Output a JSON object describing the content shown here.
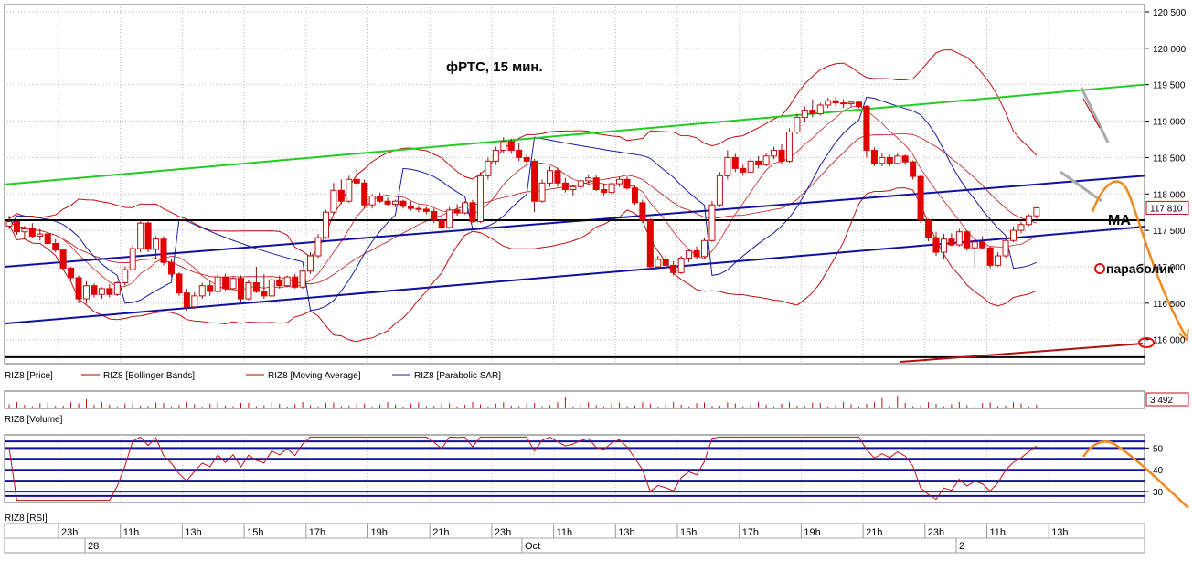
{
  "chart_data": [
    {
      "type": "candlestick",
      "title": "фРТС, 15 мин.",
      "price_axis_ticks": [
        "120 500",
        "120 000",
        "119 500",
        "119 000",
        "118 500",
        "118 000",
        "117 500",
        "117 000",
        "116 500",
        "116 000"
      ],
      "ylim": [
        115670,
        120600
      ],
      "last_price_label": "117 810",
      "last_price": 117810,
      "legend": [
        {
          "name": "RIZ8 [Price]",
          "color": "#000000"
        },
        {
          "name": "RIZ8 [Bollinger Bands]",
          "color": "#b00000"
        },
        {
          "name": "RIZ8 [Moving Average]",
          "color": "#b00000"
        },
        {
          "name": "RIZ8 [Parabolic SAR]",
          "color": "#1a1aa0"
        }
      ],
      "candles": [
        [
          117560,
          117700,
          117520,
          117620
        ],
        [
          117620,
          117640,
          117440,
          117480
        ],
        [
          117480,
          117560,
          117380,
          117520
        ],
        [
          117520,
          117600,
          117400,
          117420
        ],
        [
          117420,
          117520,
          117360,
          117450
        ],
        [
          117450,
          117470,
          117300,
          117320
        ],
        [
          117320,
          117380,
          117200,
          117230
        ],
        [
          117230,
          117250,
          116950,
          116980
        ],
        [
          116980,
          117000,
          116820,
          116850
        ],
        [
          116850,
          116880,
          116500,
          116560
        ],
        [
          116560,
          116800,
          116500,
          116740
        ],
        [
          116740,
          116770,
          116580,
          116620
        ],
        [
          116620,
          116720,
          116560,
          116700
        ],
        [
          116700,
          116760,
          116580,
          116620
        ],
        [
          116620,
          116800,
          116600,
          116780
        ],
        [
          116780,
          117000,
          116740,
          116960
        ],
        [
          116960,
          117300,
          116940,
          117250
        ],
        [
          117250,
          117650,
          117200,
          117600
        ],
        [
          117600,
          117640,
          117200,
          117240
        ],
        [
          117240,
          117420,
          117100,
          117380
        ],
        [
          117380,
          117420,
          117020,
          117060
        ],
        [
          117060,
          117100,
          116860,
          116900
        ],
        [
          116900,
          116920,
          116600,
          116640
        ],
        [
          116640,
          116700,
          116400,
          116450
        ],
        [
          116450,
          116650,
          116420,
          116600
        ],
        [
          116600,
          116780,
          116560,
          116740
        ],
        [
          116740,
          116800,
          116600,
          116660
        ],
        [
          116660,
          116900,
          116640,
          116860
        ],
        [
          116860,
          116900,
          116660,
          116700
        ],
        [
          116700,
          116860,
          116680,
          116840
        ],
        [
          116840,
          116880,
          116520,
          116560
        ],
        [
          116560,
          116820,
          116540,
          116780
        ],
        [
          116780,
          117000,
          116640,
          116660
        ],
        [
          116660,
          116900,
          116560,
          116600
        ],
        [
          116600,
          116840,
          116580,
          116820
        ],
        [
          116820,
          116880,
          116700,
          116740
        ],
        [
          116740,
          116880,
          116720,
          116860
        ],
        [
          116860,
          116900,
          116700,
          116720
        ],
        [
          116720,
          116960,
          116700,
          116940
        ],
        [
          116940,
          117200,
          116900,
          117150
        ],
        [
          117150,
          117450,
          117120,
          117400
        ],
        [
          117400,
          117780,
          117380,
          117750
        ],
        [
          117750,
          118150,
          117720,
          118050
        ],
        [
          118050,
          118200,
          117860,
          117900
        ],
        [
          117900,
          118250,
          117880,
          118200
        ],
        [
          118200,
          118350,
          118100,
          118150
        ],
        [
          118150,
          118200,
          117800,
          117850
        ],
        [
          117850,
          118000,
          117800,
          117970
        ],
        [
          117970,
          118020,
          117880,
          117900
        ],
        [
          117900,
          117950,
          117840,
          117860
        ],
        [
          117860,
          117920,
          117820,
          117900
        ],
        [
          117900,
          117920,
          117800,
          117830
        ],
        [
          117830,
          117900,
          117770,
          117800
        ],
        [
          117800,
          117840,
          117750,
          117790
        ],
        [
          117790,
          117820,
          117720,
          117760
        ],
        [
          117760,
          117800,
          117600,
          117640
        ],
        [
          117640,
          117700,
          117520,
          117540
        ],
        [
          117540,
          117820,
          117520,
          117780
        ],
        [
          117780,
          117860,
          117700,
          117740
        ],
        [
          117740,
          117900,
          117720,
          117880
        ],
        [
          117880,
          117920,
          117600,
          117620
        ],
        [
          117620,
          118300,
          117600,
          118250
        ],
        [
          118250,
          118500,
          118200,
          118450
        ],
        [
          118450,
          118650,
          118400,
          118600
        ],
        [
          118600,
          118780,
          118560,
          118720
        ],
        [
          118720,
          118760,
          118550,
          118600
        ],
        [
          118600,
          118700,
          118450,
          118500
        ],
        [
          118500,
          118550,
          118400,
          118450
        ],
        [
          118450,
          118480,
          117750,
          117900
        ],
        [
          117900,
          118200,
          117880,
          118150
        ],
        [
          118150,
          118380,
          118100,
          118320
        ],
        [
          118320,
          118360,
          118100,
          118150
        ],
        [
          118150,
          118220,
          118020,
          118060
        ],
        [
          118060,
          118120,
          117980,
          118100
        ],
        [
          118100,
          118200,
          118050,
          118180
        ],
        [
          118180,
          118260,
          118120,
          118220
        ],
        [
          118220,
          118260,
          118040,
          118060
        ],
        [
          118060,
          118140,
          117980,
          118020
        ],
        [
          118020,
          118160,
          118000,
          118140
        ],
        [
          118140,
          118240,
          118100,
          118200
        ],
        [
          118200,
          118240,
          118060,
          118080
        ],
        [
          118080,
          118120,
          117850,
          117880
        ],
        [
          117880,
          117920,
          117600,
          117640
        ],
        [
          117640,
          117660,
          116950,
          117000
        ],
        [
          117000,
          117150,
          116980,
          117100
        ],
        [
          117100,
          117160,
          116980,
          117020
        ],
        [
          117020,
          117080,
          116880,
          116920
        ],
        [
          116920,
          117150,
          116900,
          117120
        ],
        [
          117120,
          117250,
          117060,
          117220
        ],
        [
          117220,
          117280,
          117100,
          117140
        ],
        [
          117140,
          117400,
          117120,
          117360
        ],
        [
          117360,
          117900,
          117340,
          117850
        ],
        [
          117850,
          118300,
          117820,
          118250
        ],
        [
          118250,
          118600,
          118200,
          118500
        ],
        [
          118500,
          118550,
          118300,
          118350
        ],
        [
          118350,
          118400,
          118250,
          118300
        ],
        [
          118300,
          118500,
          118280,
          118450
        ],
        [
          118450,
          118520,
          118350,
          118400
        ],
        [
          118400,
          118560,
          118380,
          118520
        ],
        [
          118520,
          118650,
          118480,
          118600
        ],
        [
          118600,
          118680,
          118400,
          118450
        ],
        [
          118450,
          118900,
          118430,
          118850
        ],
        [
          118850,
          119100,
          118820,
          119050
        ],
        [
          119050,
          119200,
          118980,
          119150
        ],
        [
          119150,
          119300,
          119050,
          119100
        ],
        [
          119100,
          119250,
          119080,
          119220
        ],
        [
          119220,
          119320,
          119180,
          119280
        ],
        [
          119280,
          119330,
          119200,
          119250
        ],
        [
          119250,
          119300,
          119180,
          119240
        ],
        [
          119240,
          119280,
          119200,
          119260
        ],
        [
          119260,
          119270,
          119180,
          119200
        ],
        [
          119200,
          119220,
          118500,
          118600
        ],
        [
          118600,
          118640,
          118380,
          118420
        ],
        [
          118420,
          118560,
          118380,
          118500
        ],
        [
          118500,
          118540,
          118380,
          118420
        ],
        [
          118420,
          118560,
          118400,
          118520
        ],
        [
          118520,
          118540,
          118400,
          118440
        ],
        [
          118440,
          118460,
          118200,
          118240
        ],
        [
          118240,
          118260,
          117600,
          117640
        ],
        [
          117640,
          117660,
          117350,
          117400
        ],
        [
          117400,
          117480,
          117150,
          117200
        ],
        [
          117200,
          117450,
          117100,
          117380
        ],
        [
          117380,
          117460,
          117280,
          117300
        ],
        [
          117300,
          117520,
          117280,
          117480
        ],
        [
          117480,
          117500,
          117220,
          117260
        ],
        [
          117260,
          117380,
          117000,
          117340
        ],
        [
          117340,
          117420,
          117240,
          117260
        ],
        [
          117260,
          117280,
          116980,
          117020
        ],
        [
          117020,
          117200,
          117000,
          117150
        ],
        [
          117150,
          117400,
          117120,
          117360
        ],
        [
          117360,
          117550,
          117340,
          117500
        ],
        [
          117500,
          117620,
          117460,
          117580
        ],
        [
          117580,
          117720,
          117560,
          117700
        ],
        [
          117700,
          117820,
          117660,
          117810
        ]
      ],
      "annotations": [
        "MA",
        "параболик"
      ],
      "volume_panel": {
        "label": "RIZ8 [Volume]",
        "last_value_label": "3 492"
      },
      "rsi_panel": {
        "label": "RIZ8 [RSI]",
        "ticks": [
          "50",
          "40",
          "30"
        ],
        "levels": [
          53,
          50,
          45,
          40,
          35,
          30,
          28
        ],
        "ylim": [
          25,
          56
        ]
      },
      "time_axis": {
        "hour_labels": [
          "23h",
          "11h",
          "13h",
          "15h",
          "17h",
          "19h",
          "21h",
          "23h",
          "11h",
          "13h",
          "15h",
          "17h",
          "19h",
          "21h",
          "23h",
          "11h",
          "13h"
        ],
        "date_labels": [
          "28",
          "Oct",
          "2"
        ]
      }
    }
  ]
}
